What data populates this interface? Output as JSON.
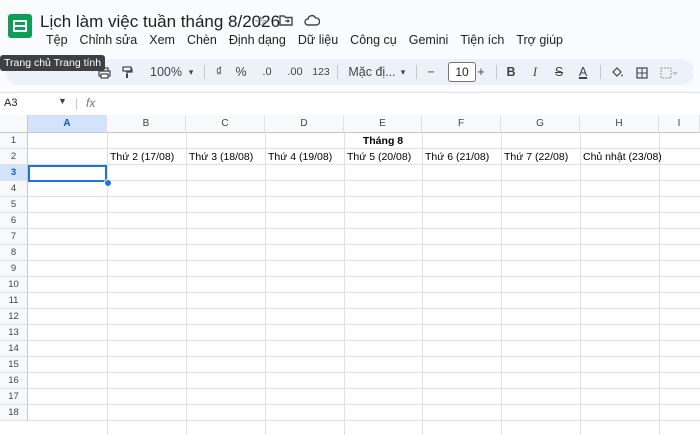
{
  "doc": {
    "title": "Lịch làm việc tuần tháng 8/2026"
  },
  "title_icons": [
    "star-icon",
    "move-folder-icon",
    "cloud-status-icon"
  ],
  "menu": [
    "Tệp",
    "Chỉnh sửa",
    "Xem",
    "Chèn",
    "Định dạng",
    "Dữ liệu",
    "Công cụ",
    "Gemini",
    "Tiện ích",
    "Trợ giúp"
  ],
  "tooltip": "Trang chủ Trang tính",
  "toolbar": {
    "zoom": "100%",
    "currency": "₫",
    "percent": "%",
    "dec_decrease": ".0",
    "dec_increase": ".00",
    "number_format": "123",
    "font": "Mặc đị...",
    "font_size": "10",
    "minus": "−",
    "plus": "+",
    "bold": "B",
    "italic": "I",
    "strike": "S",
    "text_color": "A"
  },
  "formula": {
    "namebox": "A3",
    "fx": "fx"
  },
  "columns": [
    "A",
    "B",
    "C",
    "D",
    "E",
    "F",
    "G",
    "H",
    "I"
  ],
  "rows": [
    "1",
    "2",
    "3",
    "4",
    "5",
    "6",
    "7",
    "8",
    "9",
    "10",
    "11",
    "12",
    "13",
    "14",
    "15",
    "16",
    "17",
    "18"
  ],
  "cells": {
    "e1": "Tháng 8",
    "b2": "Thứ 2 (17/08)",
    "c2": "Thứ 3 (18/08)",
    "d2": "Thứ 4 (19/08)",
    "e2": "Thứ 5 (20/08)",
    "f2": "Thứ 6 (21/08)",
    "g2": "Thứ 7 (22/08)",
    "h2": "Chủ nhật (23/08)"
  },
  "colors": {
    "accent": "#1a73e8",
    "logo": "#0f9d58",
    "toolbar_bg": "#edf2fa"
  }
}
